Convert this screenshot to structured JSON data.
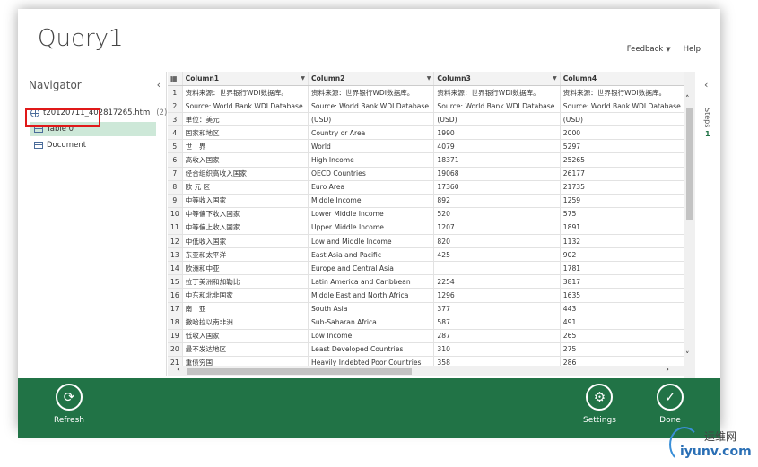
{
  "header": {
    "title": "Query1",
    "feedback": "Feedback",
    "help": "Help"
  },
  "navigator": {
    "title": "Navigator",
    "source": {
      "label": "t20120711_402817265.htm",
      "count": "(2)"
    },
    "items": [
      {
        "label": "Table 0",
        "selected": true
      },
      {
        "label": "Document",
        "selected": false
      }
    ]
  },
  "grid": {
    "columns": [
      "Column1",
      "Column2",
      "Column3",
      "Column4"
    ],
    "rows": [
      [
        "1",
        "资料来源：世界银行WDI数据库。",
        "资料来源：世界银行WDI数据库。",
        "资料来源：世界银行WDI数据库。",
        "资料来源：世界银行WDI数据库。"
      ],
      [
        "2",
        "Source: World Bank WDI Database.",
        "Source: World Bank WDI Database.",
        "Source: World Bank WDI Database.",
        "Source: World Bank WDI Database."
      ],
      [
        "3",
        "单位：美元",
        "(USD)",
        "(USD)",
        "(USD)"
      ],
      [
        "4",
        "国家和地区",
        "Country or Area",
        "1990",
        "2000"
      ],
      [
        "5",
        "世　界",
        "World",
        "4079",
        "5297"
      ],
      [
        "6",
        "高收入国家",
        "High Income",
        "18371",
        "25265"
      ],
      [
        "7",
        "经合组织高收入国家",
        "OECD Countries",
        "19068",
        "26177"
      ],
      [
        "8",
        "欧 元 区",
        "Euro Area",
        "17360",
        "21735"
      ],
      [
        "9",
        "中等收入国家",
        "Middle Income",
        "892",
        "1259"
      ],
      [
        "10",
        "中等偏下收入国家",
        "Lower Middle Income",
        "520",
        "575"
      ],
      [
        "11",
        "中等偏上收入国家",
        "Upper Middle Income",
        "1207",
        "1891"
      ],
      [
        "12",
        "中低收入国家",
        "Low and Middle Income",
        "820",
        "1132"
      ],
      [
        "13",
        "东亚和太平洋",
        "East Asia and Pacific",
        "425",
        "902"
      ],
      [
        "14",
        "欧洲和中亚",
        "Europe and Central Asia",
        "",
        "1781"
      ],
      [
        "15",
        "拉丁美洲和加勒比",
        "Latin America and Caribbean",
        "2254",
        "3817"
      ],
      [
        "16",
        "中东和北非国家",
        "Middle East and North Africa",
        "1296",
        "1635"
      ],
      [
        "17",
        "南　亚",
        "South Asia",
        "377",
        "443"
      ],
      [
        "18",
        "撒哈拉以南非洲",
        "Sub-Saharan Africa",
        "587",
        "491"
      ],
      [
        "19",
        "低收入国家",
        "Low Income",
        "287",
        "265"
      ],
      [
        "20",
        "最不发达地区",
        "Least Developed Countries",
        "310",
        "275"
      ],
      [
        "21",
        "重债穷国",
        "Heavily Indebted Poor Countries",
        "358",
        "286"
      ]
    ]
  },
  "steps": {
    "label": "Steps",
    "count": "1"
  },
  "footer": {
    "refresh": "Refresh",
    "settings": "Settings",
    "done": "Done"
  },
  "watermark": {
    "cn": "运维网",
    "url": "iyunv.com"
  },
  "colors": {
    "accent": "#217346",
    "highlight": "#e01919"
  }
}
